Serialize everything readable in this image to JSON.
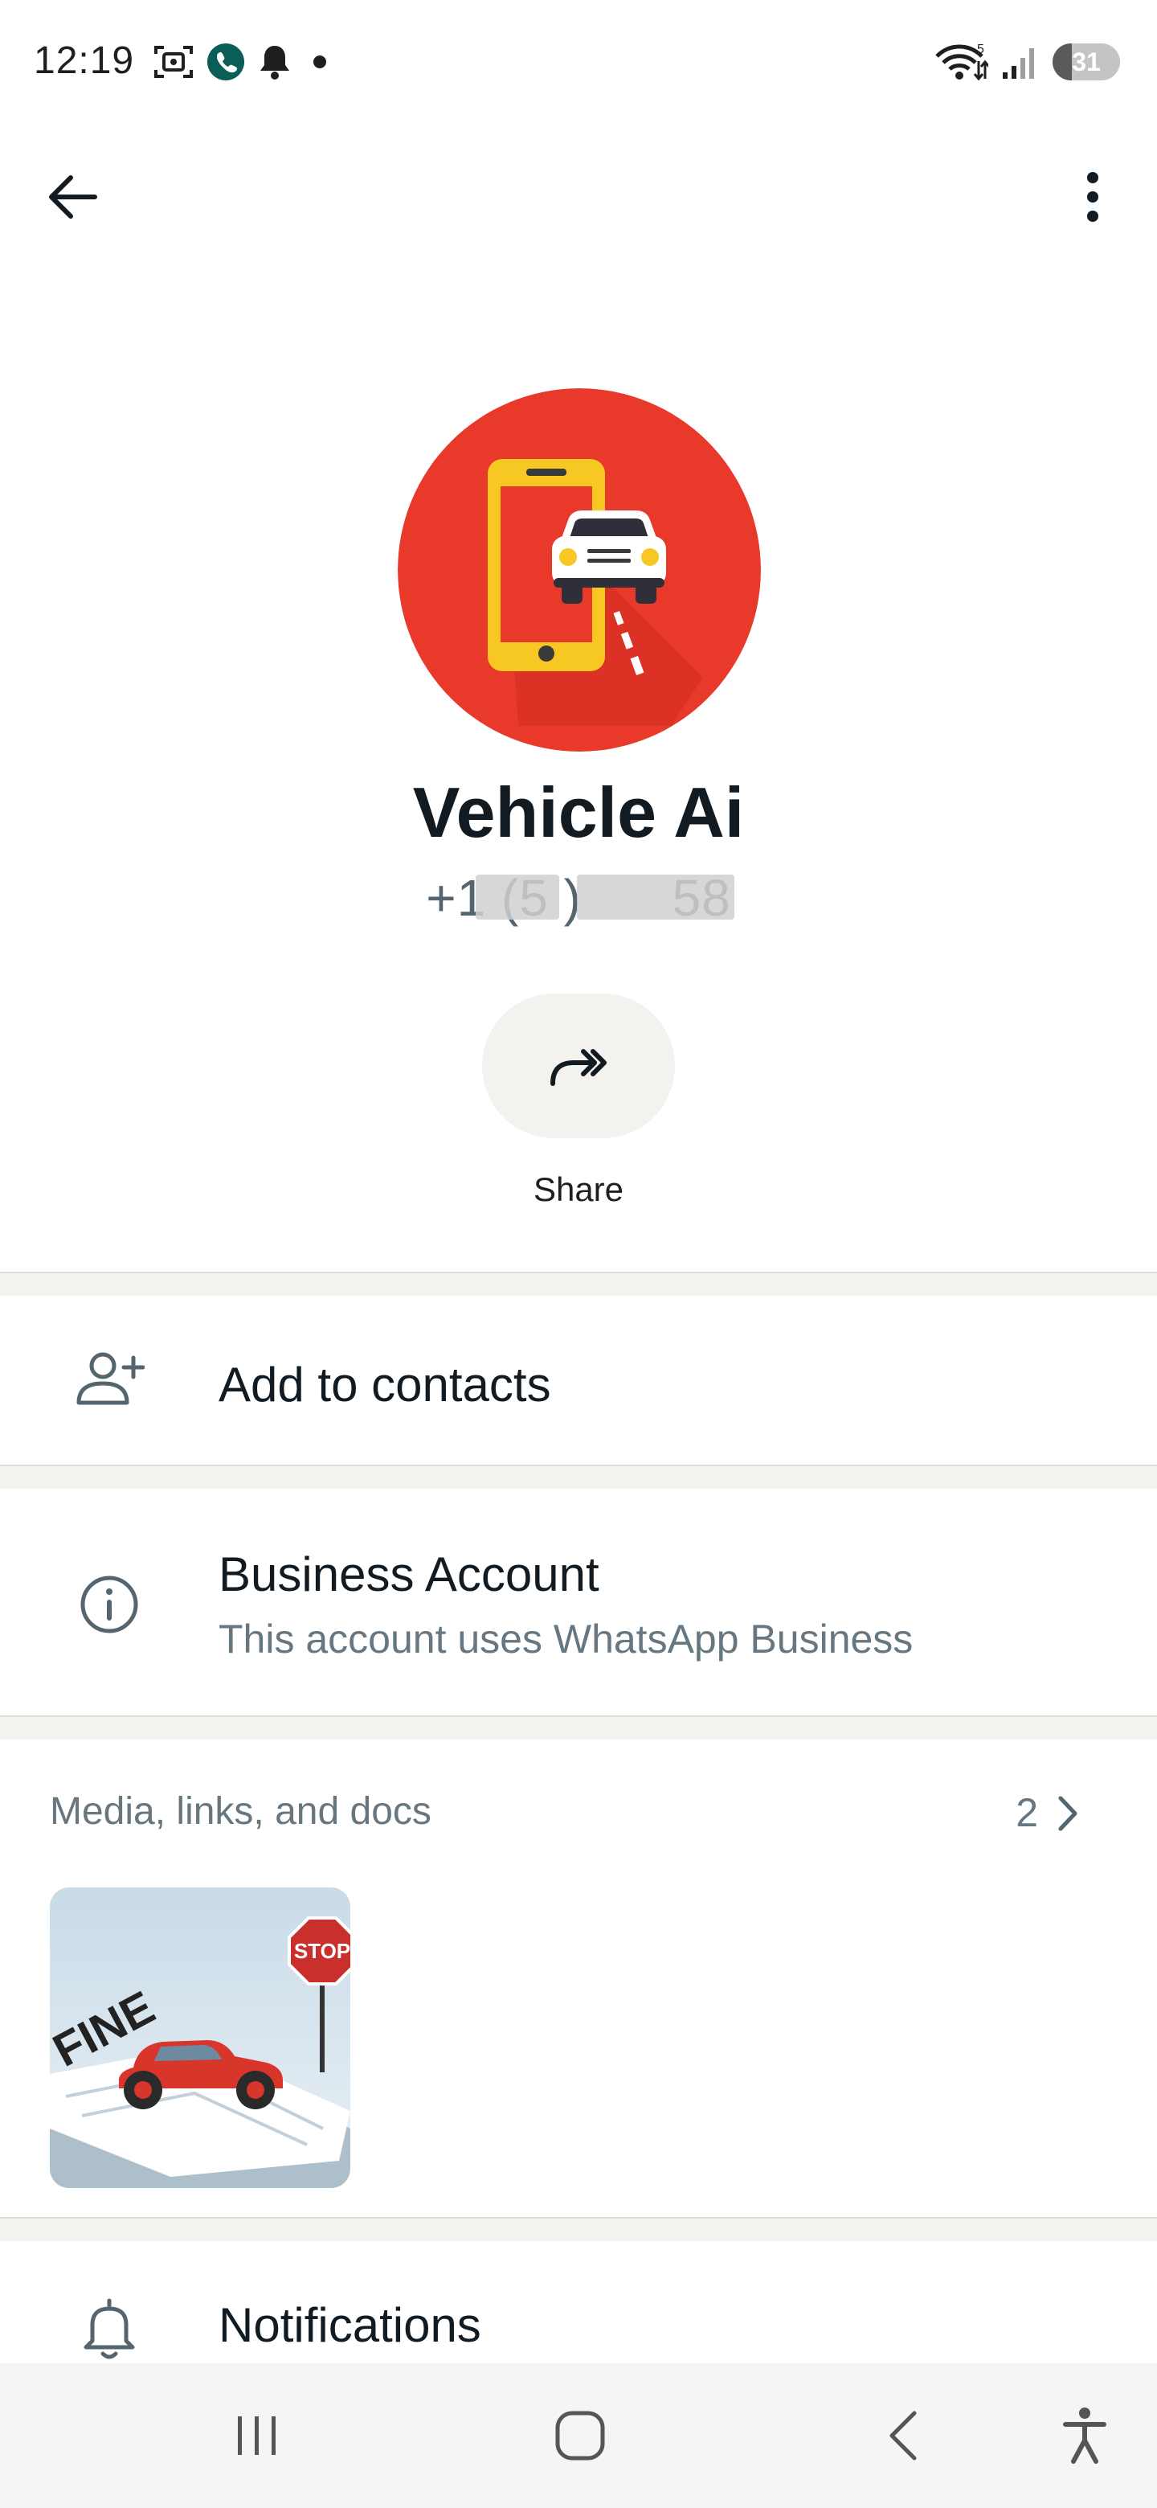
{
  "status_bar": {
    "time": "12:19",
    "battery": "31",
    "icons_left": [
      "screenshot-icon",
      "whatsapp-call-icon",
      "bell-icon",
      "dot-icon"
    ],
    "icons_right": [
      "wifi-icon",
      "signal-icon",
      "battery-icon"
    ]
  },
  "top_bar": {
    "back_icon": "arrow-left-icon",
    "menu_icon": "more-vertical-icon"
  },
  "profile": {
    "name": "Vehicle Ai",
    "phone": "+1 (5  ) ‌ ‌ ‌ ‌ ‌ ‌58",
    "avatar": "vehicle-ai-logo"
  },
  "actions": {
    "share_label": "Share"
  },
  "rows": {
    "add_contacts": "Add to contacts",
    "business_title": "Business Account",
    "business_sub": "This account uses WhatsApp Business",
    "notifications": "Notifications"
  },
  "media": {
    "title": "Media, links, and docs",
    "count": "2",
    "thumb_sign_text": "STOP",
    "thumb_paper_text": "FINE"
  },
  "colors": {
    "avatar_bg": "#e8392b",
    "phone_yellow": "#f7c824",
    "text_primary": "#111b21",
    "text_secondary": "#667781"
  }
}
